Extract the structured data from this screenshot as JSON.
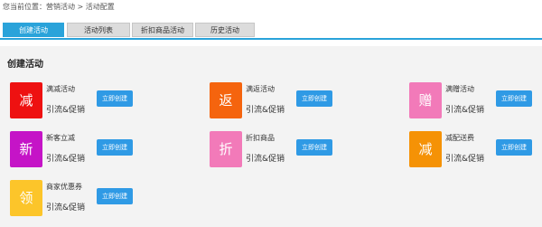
{
  "breadcrumb": "您当前位置：营销活动 > 活动配置",
  "tabs": [
    {
      "label": "创建活动",
      "active": true
    },
    {
      "label": "活动列表",
      "active": false
    },
    {
      "label": "折扣商品活动",
      "active": false
    },
    {
      "label": "历史活动",
      "active": false
    }
  ],
  "panel_title": "创建活动",
  "cards": [
    {
      "icon_char": "减",
      "icon_color": "#ee1111",
      "name": "满减活动",
      "desc": "引流&促销",
      "button": "立即创建"
    },
    {
      "icon_char": "返",
      "icon_color": "#f5640e",
      "name": "满返活动",
      "desc": "引流&促销",
      "button": "立即创建"
    },
    {
      "icon_char": "赠",
      "icon_color": "#f27ab9",
      "name": "满赠活动",
      "desc": "引流&促销",
      "button": "立即创建"
    },
    {
      "icon_char": "新",
      "icon_color": "#c514c7",
      "name": "新客立减",
      "desc": "引流&促销",
      "button": "立即创建"
    },
    {
      "icon_char": "折",
      "icon_color": "#f27ab9",
      "name": "折扣商品",
      "desc": "引流&促销",
      "button": "立即创建"
    },
    {
      "icon_char": "减",
      "icon_color": "#f59206",
      "name": "减配送费",
      "desc": "引流&促销",
      "button": "立即创建"
    },
    {
      "icon_char": "领",
      "icon_color": "#fcc52a",
      "name": "商家优惠券",
      "desc": "引流&促销",
      "button": "立即创建"
    }
  ],
  "colors": {
    "accent": "#2aa3da",
    "button": "#2f9ae5",
    "panel_bg": "#f3f3f3"
  }
}
